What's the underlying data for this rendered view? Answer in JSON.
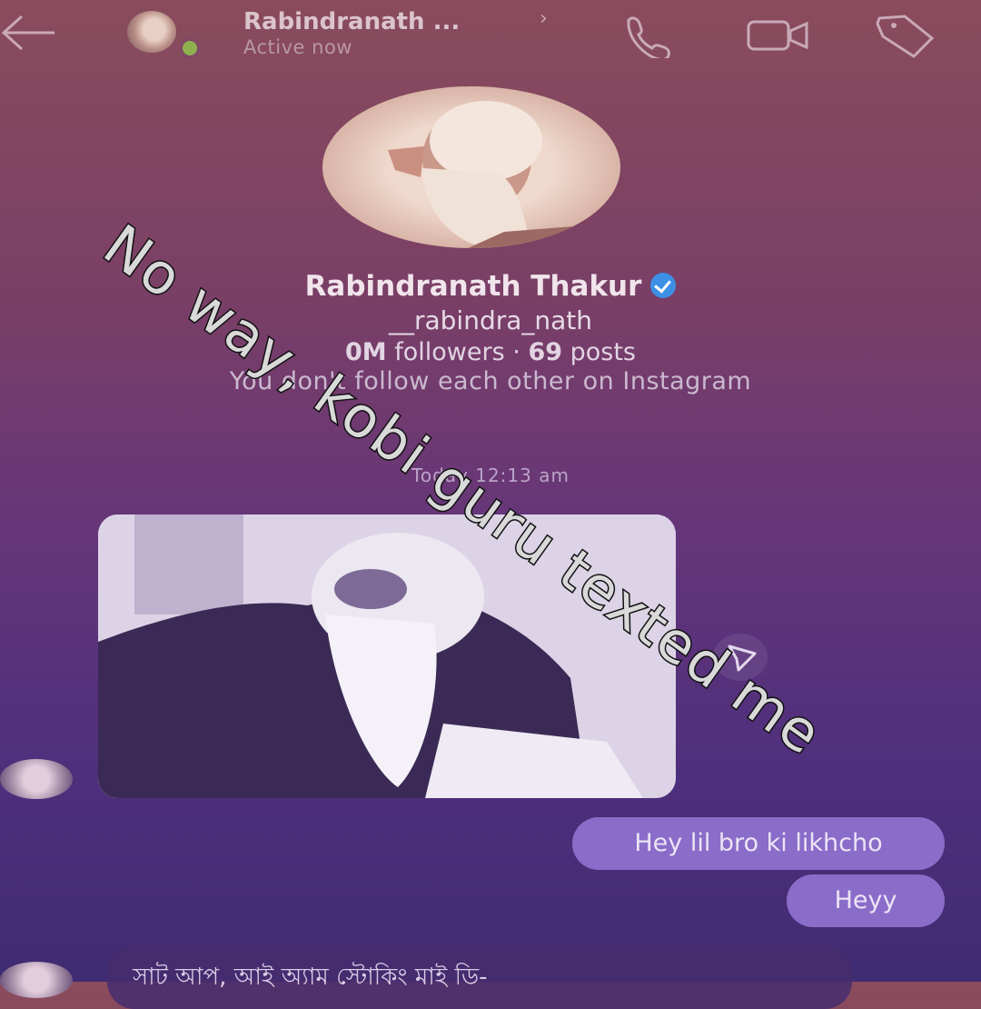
{
  "header": {
    "back_icon": "arrow-left-icon",
    "name": "Rabindranath ...",
    "status": "Active now",
    "chevron": "›",
    "actions": [
      "phone-icon",
      "video-camera-icon",
      "tag-icon"
    ]
  },
  "profile": {
    "name": "Rabindranath Thakur",
    "handle": "__rabindra_nath",
    "followers_value": "0M",
    "followers_label": "followers",
    "posts_value": "69",
    "posts_label": "posts",
    "separator": " ·",
    "note": "You don't follow each other on Instagram"
  },
  "chat": {
    "timestamp": "Today 12:13 am",
    "messages_outgoing": [
      "Hey lil bro ki likhcho",
      "Heyy"
    ],
    "incoming_partial": "সাট আপ, আই অ্যাম স্টোকিং মাই ডি-"
  },
  "overlay": {
    "caption": "No way, kobi guru texted me"
  },
  "colors": {
    "bubble": "#8a6cc9",
    "verified": "#3d90e6",
    "online": "#8fb04e"
  }
}
